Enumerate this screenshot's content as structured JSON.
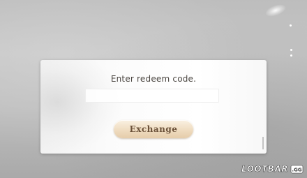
{
  "dialog": {
    "title": "Enter redeem code.",
    "input_value": "",
    "exchange_label": "Exchange"
  },
  "watermark": {
    "text": "LOOTBAR",
    "suffix": ".GG"
  },
  "colors": {
    "dialog_text": "#4a4540",
    "button_fill": "#efdcc0",
    "button_text": "#6b5139"
  }
}
